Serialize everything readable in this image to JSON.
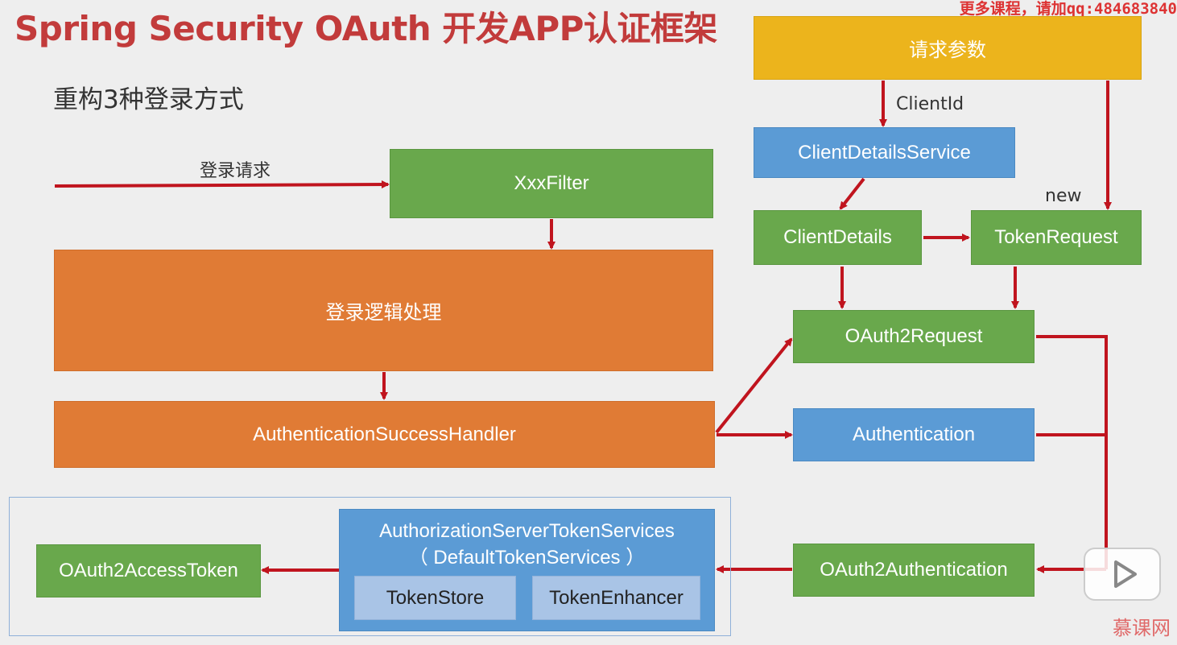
{
  "title": "Spring Security OAuth 开发APP认证框架",
  "watermark": "更多课程，请加qq:484683840",
  "subtitle": "重构3种登录方式",
  "labels": {
    "login_request": "登录请求",
    "client_id": "ClientId",
    "new": "new"
  },
  "boxes": {
    "request_params": "请求参数",
    "client_details_service": "ClientDetailsService",
    "client_details": "ClientDetails",
    "token_request": "TokenRequest",
    "xxx_filter": "XxxFilter",
    "login_logic": "登录逻辑处理",
    "success_handler": "AuthenticationSuccessHandler",
    "oauth2_request": "OAuth2Request",
    "authentication": "Authentication",
    "oauth2_authentication": "OAuth2Authentication",
    "token_services_line1": "AuthorizationServerTokenServices",
    "token_services_line2": "（ DefaultTokenServices ）",
    "token_store": "TokenStore",
    "token_enhancer": "TokenEnhancer",
    "access_token": "OAuth2AccessToken"
  },
  "logo": "慕课网",
  "colors": {
    "title": "#c23b3b",
    "arrow": "#c0141e",
    "green": "#69a84c",
    "orange": "#e07b35",
    "blue": "#5b9bd5",
    "yellow": "#ecb41c",
    "light_blue": "#a9c4e6"
  }
}
